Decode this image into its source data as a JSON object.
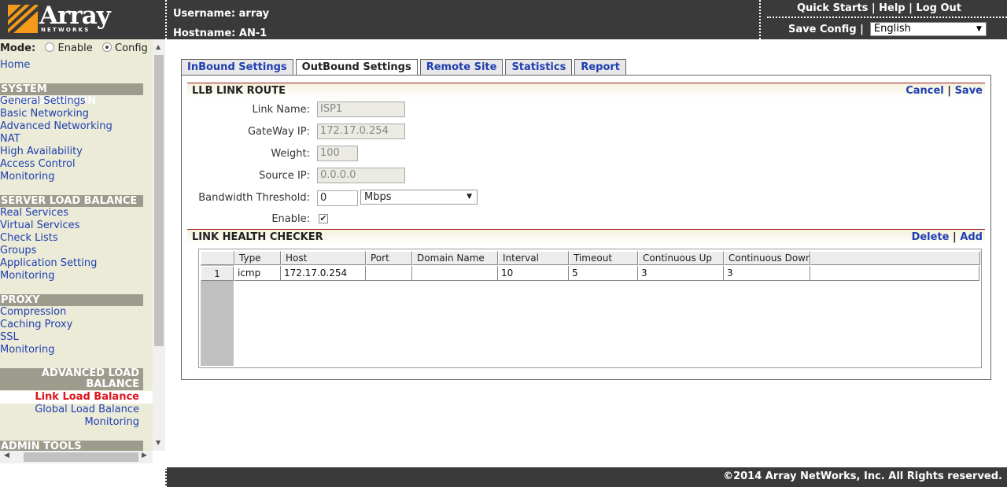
{
  "brand": {
    "name": "Array",
    "sub": "NETWORKS"
  },
  "header": {
    "username_label": "Username: array",
    "hostname_label": "Hostname: AN-1",
    "links": [
      "Quick Starts",
      "Help",
      "Log Out"
    ],
    "save_config": "Save Config",
    "language": "English"
  },
  "sidebar": {
    "mode_label": "Mode:",
    "mode_enable": "Enable",
    "mode_config": "Config",
    "mode_selected": "Config",
    "home": "Home",
    "sections": [
      {
        "title": "SYSTEM CONFIGURATION",
        "items": [
          "General Settings",
          "Basic Networking",
          "Advanced Networking",
          "NAT",
          "High Availability",
          "Access Control",
          "Monitoring"
        ]
      },
      {
        "title": "SERVER LOAD BALANCE",
        "items": [
          "Real Services",
          "Virtual Services",
          "Check Lists",
          "Groups",
          "Application Setting",
          "Monitoring"
        ]
      },
      {
        "title": "PROXY",
        "items": [
          "Compression",
          "Caching Proxy",
          "SSL",
          "Monitoring"
        ]
      },
      {
        "title_line1": "ADVANCED LOAD",
        "title_line2": "BALANCE",
        "items": [
          "Link Load Balance",
          "Global Load Balance",
          "Monitoring"
        ],
        "active": "Link Load Balance"
      },
      {
        "title": "ADMIN TOOLS"
      }
    ]
  },
  "tabs": [
    "InBound Settings",
    "OutBound Settings",
    "Remote Site",
    "Statistics",
    "Report"
  ],
  "active_tab": "OutBound Settings",
  "route": {
    "title": "LLB LINK ROUTE",
    "cancel": "Cancel",
    "save": "Save",
    "fields": {
      "link_name_label": "Link Name:",
      "link_name": "ISP1",
      "gateway_label": "GateWay IP:",
      "gateway": "172.17.0.254",
      "weight_label": "Weight:",
      "weight": "100",
      "source_label": "Source IP:",
      "source": "0.0.0.0",
      "bandwidth_label": "Bandwidth Threshold:",
      "bandwidth": "0",
      "bandwidth_unit": "Mbps",
      "enable_label": "Enable:",
      "enable_checked": true
    }
  },
  "health": {
    "title": "LINK HEALTH CHECKER",
    "delete": "Delete",
    "add": "Add",
    "columns": [
      "Type",
      "Host",
      "Port",
      "Domain Name",
      "Interval",
      "Timeout",
      "Continuous Up",
      "Continuous Down"
    ],
    "rows": [
      {
        "num": "1",
        "cells": [
          "icmp",
          "172.17.0.254",
          "",
          "",
          "10",
          "5",
          "3",
          "3"
        ]
      }
    ]
  },
  "footer": {
    "copyright": "©2014 Array NetWorks, Inc. All Rights reserved."
  },
  "colors": {
    "header_bg": "#3a3a3a",
    "link": "#1f3fb0",
    "active_link": "#e0141e",
    "sidebar_bg": "#ecebd8",
    "section_bg": "#9d9b8c",
    "accent_line": "#9b1c1c",
    "logo_orange": "#f39a1b"
  }
}
